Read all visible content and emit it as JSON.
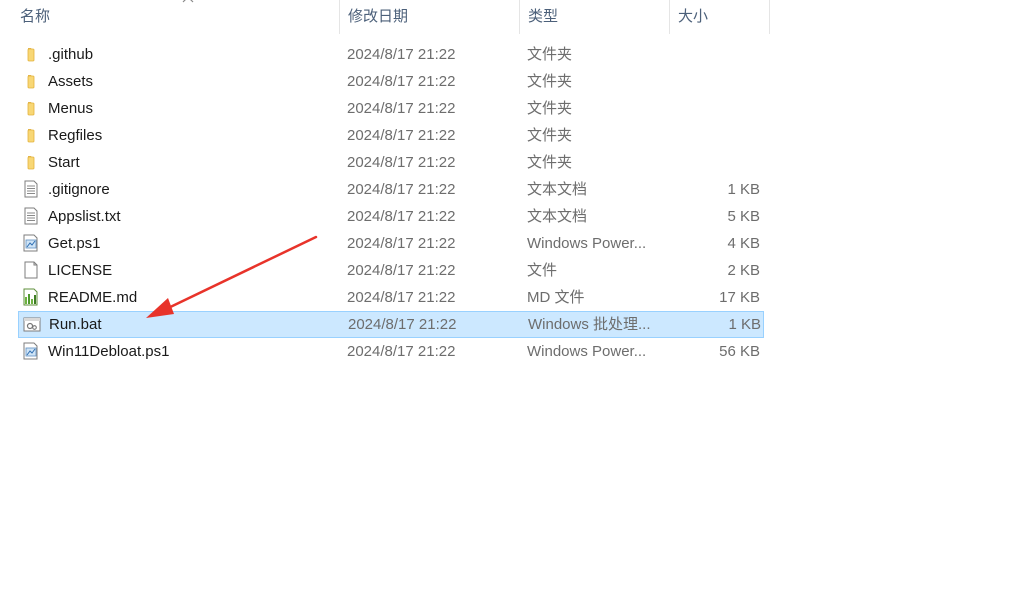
{
  "columns": {
    "name": "名称",
    "date": "修改日期",
    "type": "类型",
    "size": "大小"
  },
  "files": [
    {
      "name": ".github",
      "date": "2024/8/17 21:22",
      "type": "文件夹",
      "size": "",
      "icon": "folder-icon"
    },
    {
      "name": "Assets",
      "date": "2024/8/17 21:22",
      "type": "文件夹",
      "size": "",
      "icon": "folder-icon"
    },
    {
      "name": "Menus",
      "date": "2024/8/17 21:22",
      "type": "文件夹",
      "size": "",
      "icon": "folder-icon"
    },
    {
      "name": "Regfiles",
      "date": "2024/8/17 21:22",
      "type": "文件夹",
      "size": "",
      "icon": "folder-icon"
    },
    {
      "name": "Start",
      "date": "2024/8/17 21:22",
      "type": "文件夹",
      "size": "",
      "icon": "folder-icon"
    },
    {
      "name": ".gitignore",
      "date": "2024/8/17 21:22",
      "type": "文本文档",
      "size": "1 KB",
      "icon": "text-file-icon"
    },
    {
      "name": "Appslist.txt",
      "date": "2024/8/17 21:22",
      "type": "文本文档",
      "size": "5 KB",
      "icon": "text-file-icon"
    },
    {
      "name": "Get.ps1",
      "date": "2024/8/17 21:22",
      "type": "Windows Power...",
      "size": "4 KB",
      "icon": "powershell-file-icon"
    },
    {
      "name": "LICENSE",
      "date": "2024/8/17 21:22",
      "type": "文件",
      "size": "2 KB",
      "icon": "blank-file-icon"
    },
    {
      "name": "README.md",
      "date": "2024/8/17 21:22",
      "type": "MD 文件",
      "size": "17 KB",
      "icon": "markdown-file-icon"
    },
    {
      "name": "Run.bat",
      "date": "2024/8/17 21:22",
      "type": "Windows 批处理...",
      "size": "1 KB",
      "icon": "batch-file-icon",
      "selected": true
    },
    {
      "name": "Win11Debloat.ps1",
      "date": "2024/8/17 21:22",
      "type": "Windows Power...",
      "size": "56 KB",
      "icon": "powershell-file-icon"
    }
  ],
  "colors": {
    "selection_bg": "#cce8ff",
    "selection_border": "#99d1ff",
    "folder": "#f8d775",
    "arrow": "#e8332a"
  }
}
